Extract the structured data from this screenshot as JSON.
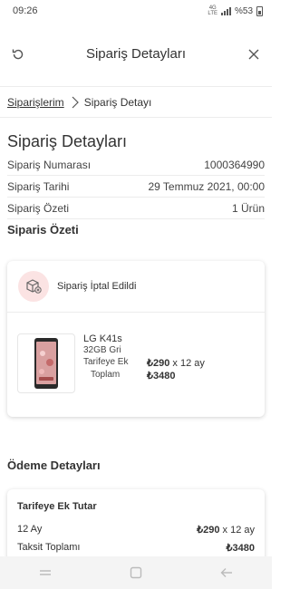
{
  "status": {
    "time": "09:26",
    "network": "4G",
    "net_small": "LTE",
    "battery": "%53"
  },
  "header": {
    "title": "Sipariş Detayları"
  },
  "breadcrumb": {
    "parent": "Siparişlerim",
    "current": "Sipariş Detayı"
  },
  "page": {
    "title": "Sipariş Detayları"
  },
  "order": {
    "number_label": "Sipariş Numarası",
    "number_value": "1000364990",
    "date_label": "Sipariş Tarihi",
    "date_value": "29 Temmuz 2021, 00:00",
    "summary_label": "Sipariş Özeti",
    "summary_value": "1 Ürün"
  },
  "summary_section": {
    "title": "Siparis Özeti"
  },
  "item": {
    "status": "Sipariş İptal Edildi",
    "name": "LG K41s",
    "variant": "32GB Gri",
    "addon_label": "Tarifeye Ek",
    "addon_value_amount": "₺290",
    "addon_value_suffix": " x 12 ay",
    "total_label": "Toplam",
    "total_value": "₺3480"
  },
  "payment": {
    "section_title": "Ödeme Detayları",
    "card_title": "Tarifeye Ek Tutar",
    "row1_label": "12 Ay",
    "row1_amount": "₺290",
    "row1_suffix": " x 12 ay",
    "row2_label": "Taksit Toplamı",
    "row2_amount": "₺3480"
  },
  "icons": {
    "back": "refresh-back-icon",
    "close": "close-icon",
    "chevron": "chevron-right-icon",
    "cancel": "cancelled-package-icon",
    "product": "phone-image",
    "nav_recent": "recent-apps-icon",
    "nav_home": "home-icon",
    "nav_back": "back-arrow-icon"
  },
  "colors": {
    "accent": "#e60000",
    "cancel_bg": "#fbe3e3",
    "nav_bg": "#f4f4f4"
  }
}
